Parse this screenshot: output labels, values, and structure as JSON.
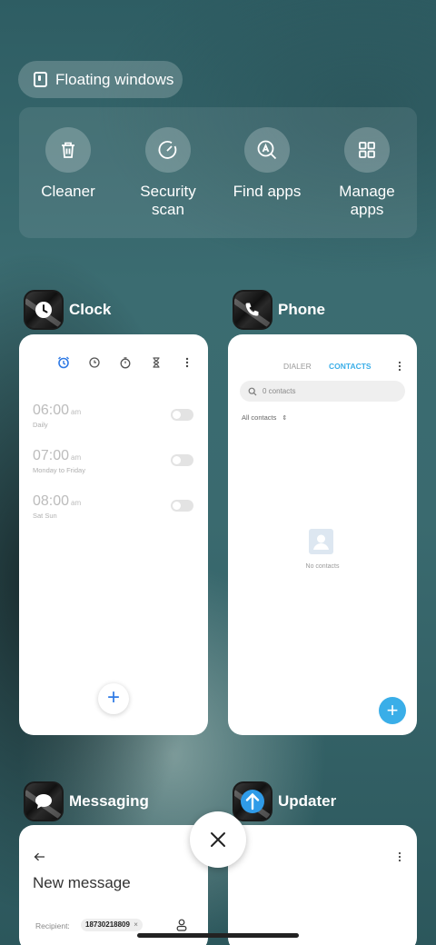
{
  "floating_windows": {
    "label": "Floating windows",
    "icon": "floating-window-icon"
  },
  "quick_actions": [
    {
      "label": "Cleaner",
      "icon": "trash-icon"
    },
    {
      "label": "Security scan",
      "icon": "security-scan-icon"
    },
    {
      "label": "Find apps",
      "icon": "find-apps-icon"
    },
    {
      "label": "Manage apps",
      "icon": "grid-icon"
    }
  ],
  "apps": {
    "clock": {
      "name": "Clock",
      "alarms": [
        {
          "time": "06:00",
          "suffix": "am",
          "repeat": "Daily"
        },
        {
          "time": "07:00",
          "suffix": "am",
          "repeat": "Monday to Friday"
        },
        {
          "time": "08:00",
          "suffix": "am",
          "repeat": "Sat Sun"
        }
      ],
      "fab": "+"
    },
    "phone": {
      "name": "Phone",
      "tabs": [
        "DIALER",
        "CONTACTS"
      ],
      "active_tab": "CONTACTS",
      "search_placeholder": "0 contacts",
      "filter": "All contacts",
      "empty_text": "No contacts",
      "fab": "+"
    },
    "messaging": {
      "name": "Messaging",
      "title": "New message",
      "recipient_label": "Recipient:",
      "recipient_chip": "18730218809",
      "chip_close": "×"
    },
    "updater": {
      "name": "Updater"
    }
  },
  "colors": {
    "accent_blue": "#2f7ae5",
    "contacts_blue": "#3aaee8"
  }
}
